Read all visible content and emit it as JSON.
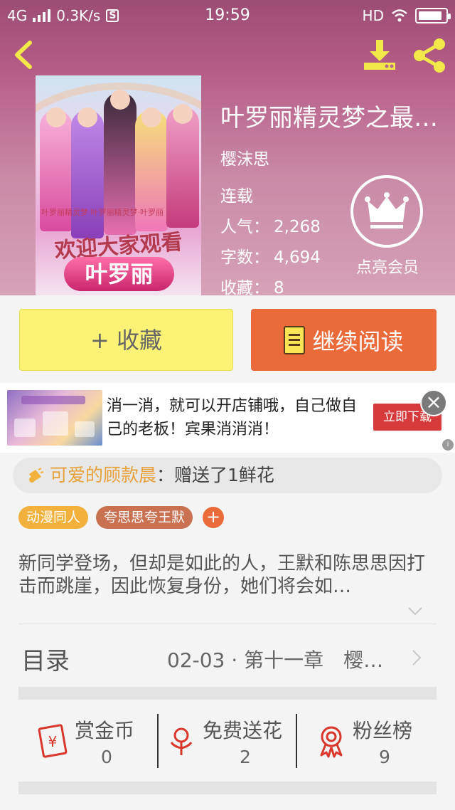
{
  "status_bar": {
    "network": "4G",
    "speed": "0.3K/s",
    "sim_badge": "S",
    "time": "19:59",
    "hd": "HD",
    "battery_level": 0.9
  },
  "header": {
    "back_icon": "chevron-left-icon",
    "download_icon": "download-icon",
    "share_icon": "share-icon"
  },
  "book": {
    "cover_ribbon_text": "叶罗丽精灵梦·叶罗丽精灵梦·叶罗丽",
    "cover_welcome_text": "欢迎大家观看",
    "cover_logo_text": "叶罗丽",
    "title": "叶罗丽精灵梦之最…",
    "author": "樱沫思",
    "status": "连载",
    "stats": [
      {
        "label": "人气：",
        "value": "2,268"
      },
      {
        "label": "字数：",
        "value": "4,694"
      },
      {
        "label": "收藏：",
        "value": "8"
      }
    ],
    "vip_label": "点亮会员",
    "vip_icon": "crown-icon"
  },
  "actions": {
    "collect_label": "+ 收藏",
    "read_label": "继续阅读",
    "read_icon": "book-icon"
  },
  "ad": {
    "text": "消一消，就可以开店铺哦，自己做自己的老板！宾果消消消！",
    "button_label": "立即下载",
    "close_icon": "close-icon"
  },
  "notice": {
    "icon": "megaphone-icon",
    "name": "可爱的顾款晨",
    "action": "：赠送了1鲜花"
  },
  "tags": [
    "动漫同人",
    "夸思思夸王默"
  ],
  "tag_add_label": "+",
  "synopsis": "新同学登场，但却是如此的人，王默和陈思思因打击而跳崖，因此恢复身份，她们将会如…",
  "catalog": {
    "title": "目录",
    "latest": "02-03 · 第十一章　樱…"
  },
  "bottom_stats": [
    {
      "label": "赏金币",
      "value": "0",
      "icon": "red-envelope-icon",
      "color": "#d9372c"
    },
    {
      "label": "免费送花",
      "value": "2",
      "icon": "flower-icon",
      "color": "#d9372c"
    },
    {
      "label": "粉丝榜",
      "value": "9",
      "icon": "medal-icon",
      "color": "#d9372c"
    }
  ]
}
